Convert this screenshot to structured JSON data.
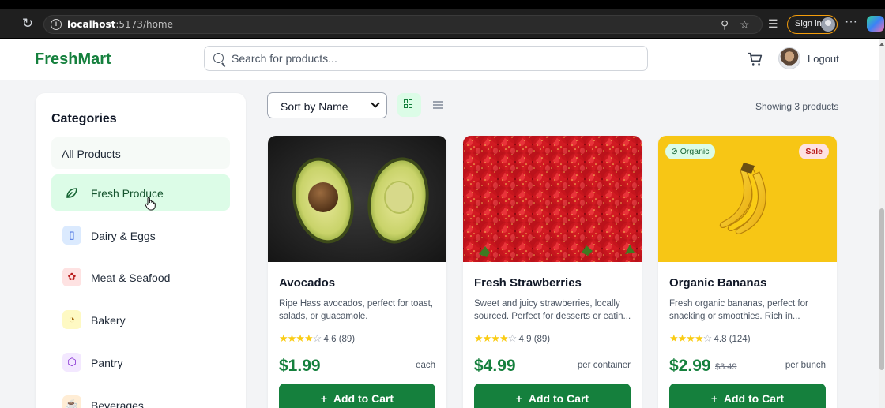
{
  "browser": {
    "url_host": "localhost",
    "url_path": ":5173/home",
    "sign_in_label": "Sign in",
    "more_label": "···"
  },
  "header": {
    "logo": "FreshMart",
    "search_placeholder": "Search for products...",
    "logout_label": "Logout"
  },
  "sidebar": {
    "title": "Categories",
    "items": [
      {
        "label": "All Products",
        "icon": "none"
      },
      {
        "label": "Fresh Produce",
        "icon": "leaf-icon",
        "active": true
      },
      {
        "label": "Dairy & Eggs",
        "icon": "milk-icon"
      },
      {
        "label": "Meat & Seafood",
        "icon": "fish-icon"
      },
      {
        "label": "Bakery",
        "icon": "croissant-icon"
      },
      {
        "label": "Pantry",
        "icon": "package-icon"
      },
      {
        "label": "Beverages",
        "icon": "coffee-icon"
      }
    ]
  },
  "toolbar": {
    "sort_label": "Sort by Name",
    "showing_text": "Showing 3 products"
  },
  "products": [
    {
      "name": "Avocados",
      "description": "Ripe Hass avocados, perfect for toast, salads, or guacamole.",
      "rating": "4.6",
      "reviews": "(89)",
      "price": "$1.99",
      "unit": "each",
      "add_label": "Add to Cart"
    },
    {
      "name": "Fresh Strawberries",
      "description": "Sweet and juicy strawberries, locally sourced. Perfect for desserts or eatin...",
      "rating": "4.9",
      "reviews": "(89)",
      "price": "$4.99",
      "unit": "per container",
      "add_label": "Add to Cart"
    },
    {
      "name": "Organic Bananas",
      "description": "Fresh organic bananas, perfect for snacking or smoothies. Rich in...",
      "rating": "4.8",
      "reviews": "(124)",
      "price": "$2.99",
      "old_price": "$3.49",
      "unit": "per bunch",
      "add_label": "Add to Cart",
      "badge_organic": "Organic",
      "badge_sale": "Sale"
    }
  ],
  "colors": {
    "brand": "#15803d",
    "active_bg": "#dcfce7",
    "star": "#facc15"
  }
}
